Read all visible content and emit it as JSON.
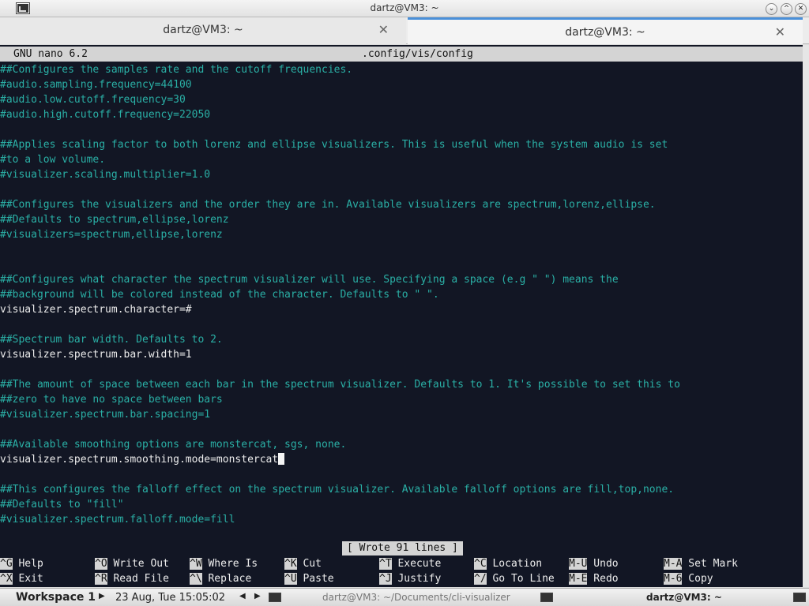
{
  "window": {
    "title": "dartz@VM3: ~",
    "icon": "terminal-icon",
    "controls": [
      "collapse-icon",
      "maximize-icon",
      "close-icon"
    ]
  },
  "tabs": [
    {
      "label": "dartz@VM3: ~",
      "active": false
    },
    {
      "label": "dartz@VM3: ~",
      "active": true
    }
  ],
  "nano": {
    "version": "GNU nano 6.2",
    "filename": ".config/vis/config",
    "status": "[ Wrote 91 lines ]"
  },
  "lines": [
    {
      "text": "##Configures the samples rate and the cutoff frequencies.",
      "kind": "comment"
    },
    {
      "text": "#audio.sampling.frequency=44100",
      "kind": "comment"
    },
    {
      "text": "#audio.low.cutoff.frequency=30",
      "kind": "comment"
    },
    {
      "text": "#audio.high.cutoff.frequency=22050",
      "kind": "comment"
    },
    {
      "text": "",
      "kind": "blank"
    },
    {
      "text": "##Applies scaling factor to both lorenz and ellipse visualizers. This is useful when the system audio is set",
      "kind": "comment"
    },
    {
      "text": "#to a low volume.",
      "kind": "comment"
    },
    {
      "text": "#visualizer.scaling.multiplier=1.0",
      "kind": "comment"
    },
    {
      "text": "",
      "kind": "blank"
    },
    {
      "text": "##Configures the visualizers and the order they are in. Available visualizers are spectrum,lorenz,ellipse.",
      "kind": "comment"
    },
    {
      "text": "##Defaults to spectrum,ellipse,lorenz",
      "kind": "comment"
    },
    {
      "text": "#visualizers=spectrum,ellipse,lorenz",
      "kind": "comment"
    },
    {
      "text": "",
      "kind": "blank"
    },
    {
      "text": "",
      "kind": "blank"
    },
    {
      "text": "##Configures what character the spectrum visualizer will use. Specifying a space (e.g \" \") means the",
      "kind": "comment"
    },
    {
      "text": "##background will be colored instead of the character. Defaults to \" \".",
      "kind": "comment"
    },
    {
      "text": "visualizer.spectrum.character=#",
      "kind": "setting"
    },
    {
      "text": "",
      "kind": "blank"
    },
    {
      "text": "##Spectrum bar width. Defaults to 2.",
      "kind": "comment"
    },
    {
      "text": "visualizer.spectrum.bar.width=1",
      "kind": "setting"
    },
    {
      "text": "",
      "kind": "blank"
    },
    {
      "text": "##The amount of space between each bar in the spectrum visualizer. Defaults to 1. It's possible to set this to",
      "kind": "comment"
    },
    {
      "text": "##zero to have no space between bars",
      "kind": "comment"
    },
    {
      "text": "#visualizer.spectrum.bar.spacing=1",
      "kind": "comment"
    },
    {
      "text": "",
      "kind": "blank"
    },
    {
      "text": "##Available smoothing options are monstercat, sgs, none.",
      "kind": "comment"
    },
    {
      "text": "visualizer.spectrum.smoothing.mode=monstercat",
      "kind": "setting",
      "cursor": true
    },
    {
      "text": "",
      "kind": "blank"
    },
    {
      "text": "##This configures the falloff effect on the spectrum visualizer. Available falloff options are fill,top,none.",
      "kind": "comment"
    },
    {
      "text": "##Defaults to \"fill\"",
      "kind": "comment"
    },
    {
      "text": "#visualizer.spectrum.falloff.mode=fill",
      "kind": "comment"
    }
  ],
  "shortcuts": [
    [
      {
        "key": "^G",
        "label": "Help"
      },
      {
        "key": "^O",
        "label": "Write Out"
      },
      {
        "key": "^W",
        "label": "Where Is"
      },
      {
        "key": "^K",
        "label": "Cut"
      },
      {
        "key": "^T",
        "label": "Execute"
      },
      {
        "key": "^C",
        "label": "Location"
      },
      {
        "key": "M-U",
        "label": "Undo"
      },
      {
        "key": "M-A",
        "label": "Set Mark"
      }
    ],
    [
      {
        "key": "^X",
        "label": "Exit"
      },
      {
        "key": "^R",
        "label": "Read File"
      },
      {
        "key": "^\\",
        "label": "Replace"
      },
      {
        "key": "^U",
        "label": "Paste"
      },
      {
        "key": "^J",
        "label": "Justify"
      },
      {
        "key": "^/",
        "label": "Go To Line"
      },
      {
        "key": "M-E",
        "label": "Redo"
      },
      {
        "key": "M-6",
        "label": "Copy"
      }
    ]
  ],
  "panel": {
    "workspace": "Workspace 1",
    "clock": "23 Aug, Tue 15:05:02",
    "tasks": [
      {
        "label": "dartz@VM3: ~/Documents/cli-visualizer",
        "active": false
      },
      {
        "label": "dartz@VM3: ~",
        "active": true
      }
    ]
  },
  "colors": {
    "terminal_bg": "#121624",
    "comment": "#2ab0a6",
    "text": "#ededed",
    "tab_accent": "#4a90d9"
  }
}
